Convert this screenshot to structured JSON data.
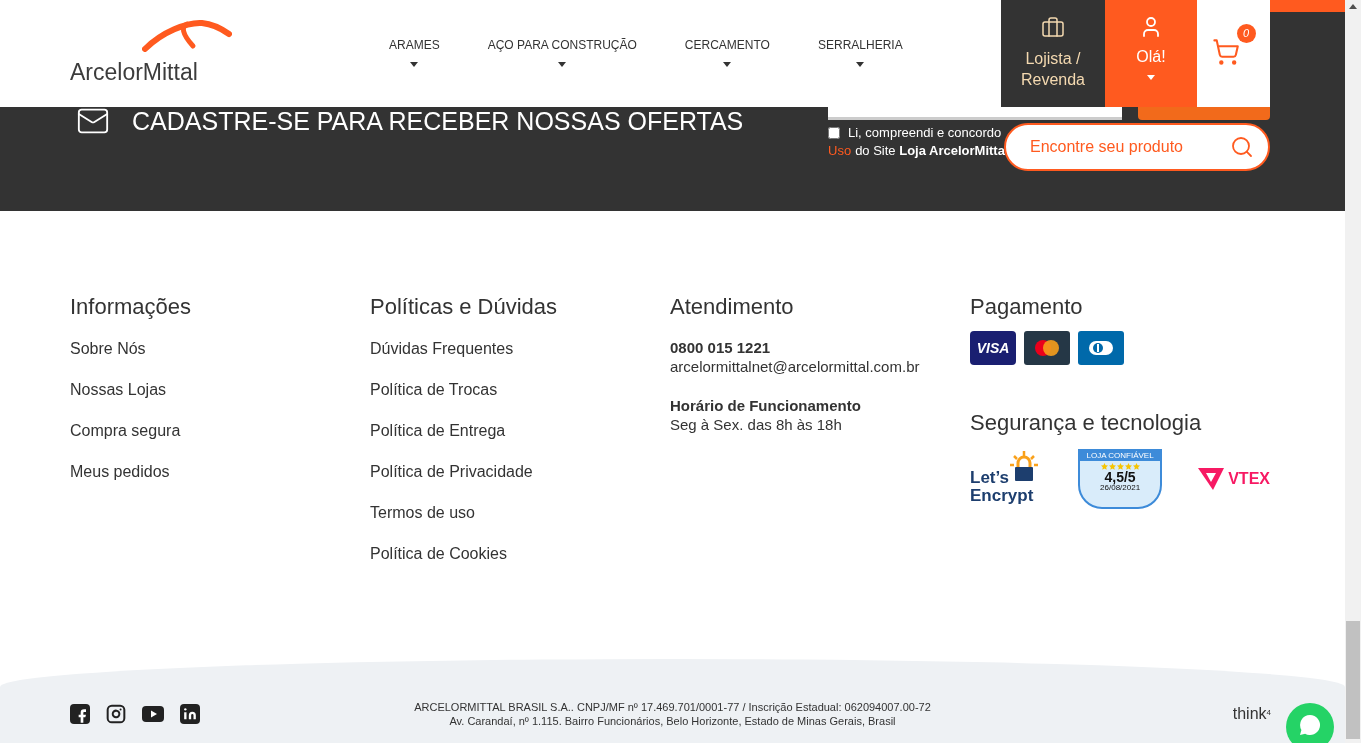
{
  "header": {
    "logo": "ArcelorMittal",
    "nav": [
      {
        "label": "ARAMES",
        "has_menu": true
      },
      {
        "label": "AÇO PARA CONSTRUÇÃO",
        "has_menu": true
      },
      {
        "label": "CERCAMENTO",
        "has_menu": true
      },
      {
        "label": "SERRALHERIA",
        "has_menu": true
      }
    ],
    "reseller": {
      "line1": "Lojista /",
      "line2": "Revenda"
    },
    "account": {
      "label": "Olá!",
      "has_menu": true
    },
    "cart": {
      "count": "0"
    },
    "search": {
      "placeholder": "Encontre seu produto"
    }
  },
  "newsletter": {
    "heading": "CADASTRE-SE PARA RECEBER NOSSAS OFERTAS",
    "consent": {
      "checked": false,
      "line1": "Li, compreendi e concordo",
      "link": "Uso",
      "line2": "do Site **Loja ArcelorMitta**"
    }
  },
  "columns": [
    {
      "title": "Informações",
      "links": [
        "Sobre Nós",
        "Nossas Lojas",
        "Compra segura",
        "Meus pedidos"
      ]
    },
    {
      "title": "Políticas e Dúvidas",
      "links": [
        "Dúvidas Frequentes",
        "Política de Trocas",
        "Política de Entrega",
        "Política de Privacidade",
        "Termos de uso",
        "Política de Cookies"
      ]
    }
  ],
  "contact": {
    "title": "Atendimento",
    "phone": "0800 015 1221",
    "email": "arcelormittalnet@arcelormittal.com.br",
    "hours_title": "Horário de Funcionamento",
    "hours": "Seg à Sex. das 8h às 18h"
  },
  "payment": {
    "title": "Pagamento",
    "methods": [
      {
        "kind": "visa",
        "label": "VISA"
      },
      {
        "kind": "mastercard"
      },
      {
        "kind": "diners"
      }
    ]
  },
  "security": {
    "title": "Segurança e tecnologia",
    "badges": [
      {
        "kind": "letsencrypt",
        "line1": "Let’s",
        "line2": "Encrypt"
      },
      {
        "kind": "review",
        "top": "LOJA CONFIÁVEL",
        "stars": 5,
        "score": "4,5/5",
        "date": "26/08/2021"
      },
      {
        "kind": "vtex",
        "label": "VTEX"
      }
    ]
  },
  "bottom": {
    "social": [
      {
        "kind": "facebook"
      },
      {
        "kind": "instagram"
      },
      {
        "kind": "youtube"
      },
      {
        "kind": "linkedin"
      }
    ],
    "legal": [
      "ARCELORMITTAL BRASIL S.A.. CNPJ/MF nº 17.469.701/0001-77 / Inscrição Estadual: 062094007.00-72",
      "Av. Carandaí, nº 1.115. Bairro Funcionários, Belo Horizonte, Estado de Minas Gerais, Brasil"
    ],
    "credit": "think",
    "credit_mark": "4"
  }
}
